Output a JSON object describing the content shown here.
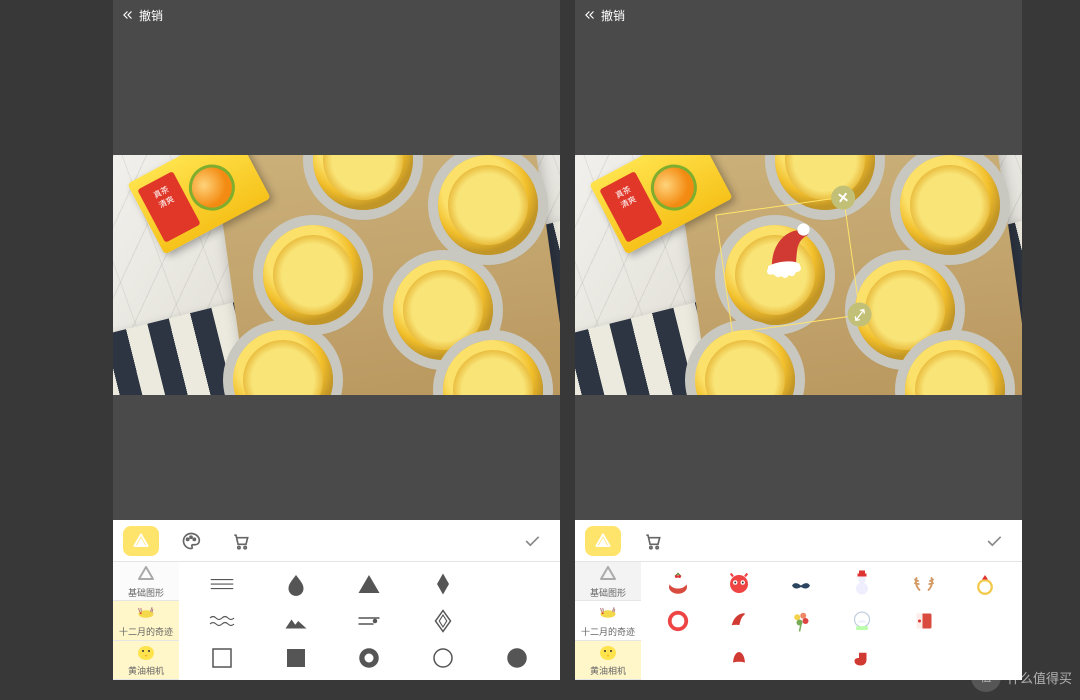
{
  "topbar": {
    "undo_label": "撤销"
  },
  "toolbar": {
    "tabs": [
      "shapes",
      "palette",
      "store"
    ],
    "active": "shapes"
  },
  "categories": [
    {
      "id": "basic",
      "label": "基础图形",
      "icon": "triangle"
    },
    {
      "id": "december",
      "label": "十二月的奇迹",
      "icon": "reindeer"
    },
    {
      "id": "butter",
      "label": "黄油相机",
      "icon": "chick"
    }
  ],
  "left_grid_kind": "shapes",
  "left_shapes": [
    "line-double",
    "drop",
    "triangle-solid",
    "diamond-solid",
    "wavy",
    "mountain",
    "cloud-line",
    "diamond-outline",
    "square-outline",
    "square-solid",
    "circle-hole",
    "circle-outline",
    "circle-solid"
  ],
  "right_selected_category": "december",
  "right_stickers": [
    "pudding",
    "monster",
    "mustache",
    "snowman",
    "antlers",
    "ring",
    "wreath",
    "santa-hat",
    "bouquet",
    "snowglobe",
    "card",
    "blank",
    "blank",
    "hat-red",
    "blank",
    "stocking",
    "blank",
    "blank"
  ],
  "watermark": {
    "badge": "值",
    "text": "什么值得买"
  }
}
